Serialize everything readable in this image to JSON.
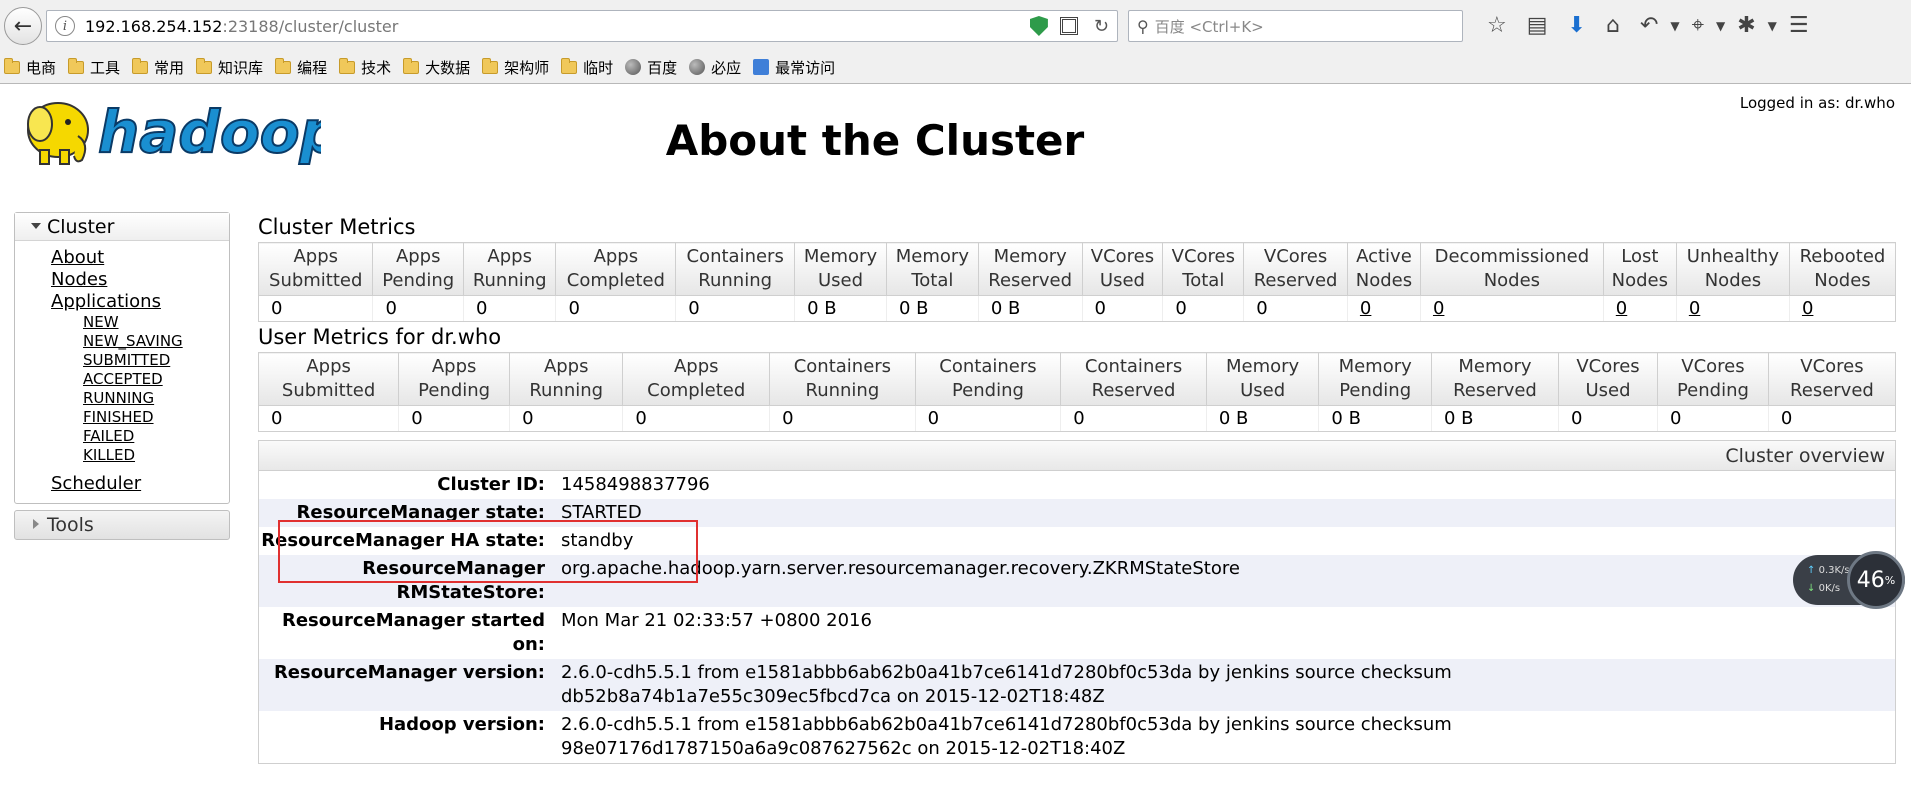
{
  "browser": {
    "url_host": "192.168.254.152",
    "url_path": ":23188/cluster/cluster",
    "search_placeholder": "百度 <Ctrl+K>",
    "bookmarks": [
      {
        "label": "电商",
        "icon": "folder-icon"
      },
      {
        "label": "工具",
        "icon": "folder-icon"
      },
      {
        "label": "常用",
        "icon": "folder-icon"
      },
      {
        "label": "知识库",
        "icon": "folder-icon"
      },
      {
        "label": "编程",
        "icon": "folder-icon"
      },
      {
        "label": "技术",
        "icon": "folder-icon"
      },
      {
        "label": "大数据",
        "icon": "folder-icon"
      },
      {
        "label": "架构师",
        "icon": "folder-icon"
      },
      {
        "label": "临时",
        "icon": "folder-icon"
      },
      {
        "label": "百度",
        "icon": "globe-icon"
      },
      {
        "label": "必应",
        "icon": "globe-icon"
      },
      {
        "label": "最常访问",
        "icon": "most-visited-icon"
      }
    ]
  },
  "header": {
    "logged_in": "Logged in as: dr.who",
    "title": "About the Cluster",
    "logo_text": "hadoop"
  },
  "sidebar": {
    "cluster_label": "Cluster",
    "links": [
      "About",
      "Nodes",
      "Applications"
    ],
    "app_states": [
      "NEW",
      "NEW_SAVING",
      "SUBMITTED",
      "ACCEPTED",
      "RUNNING",
      "FINISHED",
      "FAILED",
      "KILLED"
    ],
    "scheduler": "Scheduler",
    "tools_label": "Tools"
  },
  "cluster_metrics": {
    "title": "Cluster Metrics",
    "headers": [
      [
        "Apps",
        "Submitted"
      ],
      [
        "Apps",
        "Pending"
      ],
      [
        "Apps",
        "Running"
      ],
      [
        "Apps",
        "Completed"
      ],
      [
        "Containers",
        "Running"
      ],
      [
        "Memory",
        "Used"
      ],
      [
        "Memory",
        "Total"
      ],
      [
        "Memory",
        "Reserved"
      ],
      [
        "VCores",
        "Used"
      ],
      [
        "VCores",
        "Total"
      ],
      [
        "VCores",
        "Reserved"
      ],
      [
        "Active",
        "Nodes"
      ],
      [
        "Decommissioned",
        "Nodes"
      ],
      [
        "Lost",
        "Nodes"
      ],
      [
        "Unhealthy",
        "Nodes"
      ],
      [
        "Rebooted",
        "Nodes"
      ]
    ],
    "values": [
      "0",
      "0",
      "0",
      "0",
      "0",
      "0 B",
      "0 B",
      "0 B",
      "0",
      "0",
      "0",
      "0",
      "0",
      "0",
      "0",
      "0"
    ],
    "linked": [
      false,
      false,
      false,
      false,
      false,
      false,
      false,
      false,
      false,
      false,
      false,
      true,
      true,
      true,
      true,
      true
    ]
  },
  "user_metrics": {
    "title": "User Metrics for dr.who",
    "headers": [
      [
        "Apps",
        "Submitted"
      ],
      [
        "Apps",
        "Pending"
      ],
      [
        "Apps",
        "Running"
      ],
      [
        "Apps",
        "Completed"
      ],
      [
        "Containers",
        "Running"
      ],
      [
        "Containers",
        "Pending"
      ],
      [
        "Containers",
        "Reserved"
      ],
      [
        "Memory",
        "Used"
      ],
      [
        "Memory",
        "Pending"
      ],
      [
        "Memory",
        "Reserved"
      ],
      [
        "VCores",
        "Used"
      ],
      [
        "VCores",
        "Pending"
      ],
      [
        "VCores",
        "Reserved"
      ]
    ],
    "values": [
      "0",
      "0",
      "0",
      "0",
      "0",
      "0",
      "0",
      "0 B",
      "0 B",
      "0 B",
      "0",
      "0",
      "0"
    ]
  },
  "overview": {
    "title": "Cluster overview",
    "rows": [
      {
        "key": "Cluster ID:",
        "value": "1458498837796"
      },
      {
        "key": "ResourceManager state:",
        "value": "STARTED"
      },
      {
        "key": "ResourceManager HA state:",
        "value": "standby"
      },
      {
        "key": "ResourceManager RMStateStore:",
        "value": "org.apache.hadoop.yarn.server.resourcemanager.recovery.ZKRMStateStore"
      },
      {
        "key": "ResourceManager started on:",
        "value": "Mon Mar 21 02:33:57 +0800 2016"
      },
      {
        "key": "ResourceManager version:",
        "value": "2.6.0-cdh5.5.1 from e1581abbb6ab62b0a41b7ce6141d7280bf0c53da by jenkins source checksum db52b8a74b1a7e55c309ec5fbcd7ca on 2015-12-02T18:48Z"
      },
      {
        "key": "Hadoop version:",
        "value": "2.6.0-cdh5.5.1 from e1581abbb6ab62b0a41b7ce6141d7280bf0c53da by jenkins source checksum 98e07176d1787150a6a9c087627562c on 2015-12-02T18:40Z"
      }
    ]
  },
  "speed_widget": {
    "up": "0.3K/s",
    "down": "0K/s",
    "percent": "46",
    "unit": "%"
  },
  "colors": {
    "highlight": "#e03030",
    "hadoop_blue": "#1a8fd1",
    "hadoop_yellow": "#f5d800"
  }
}
